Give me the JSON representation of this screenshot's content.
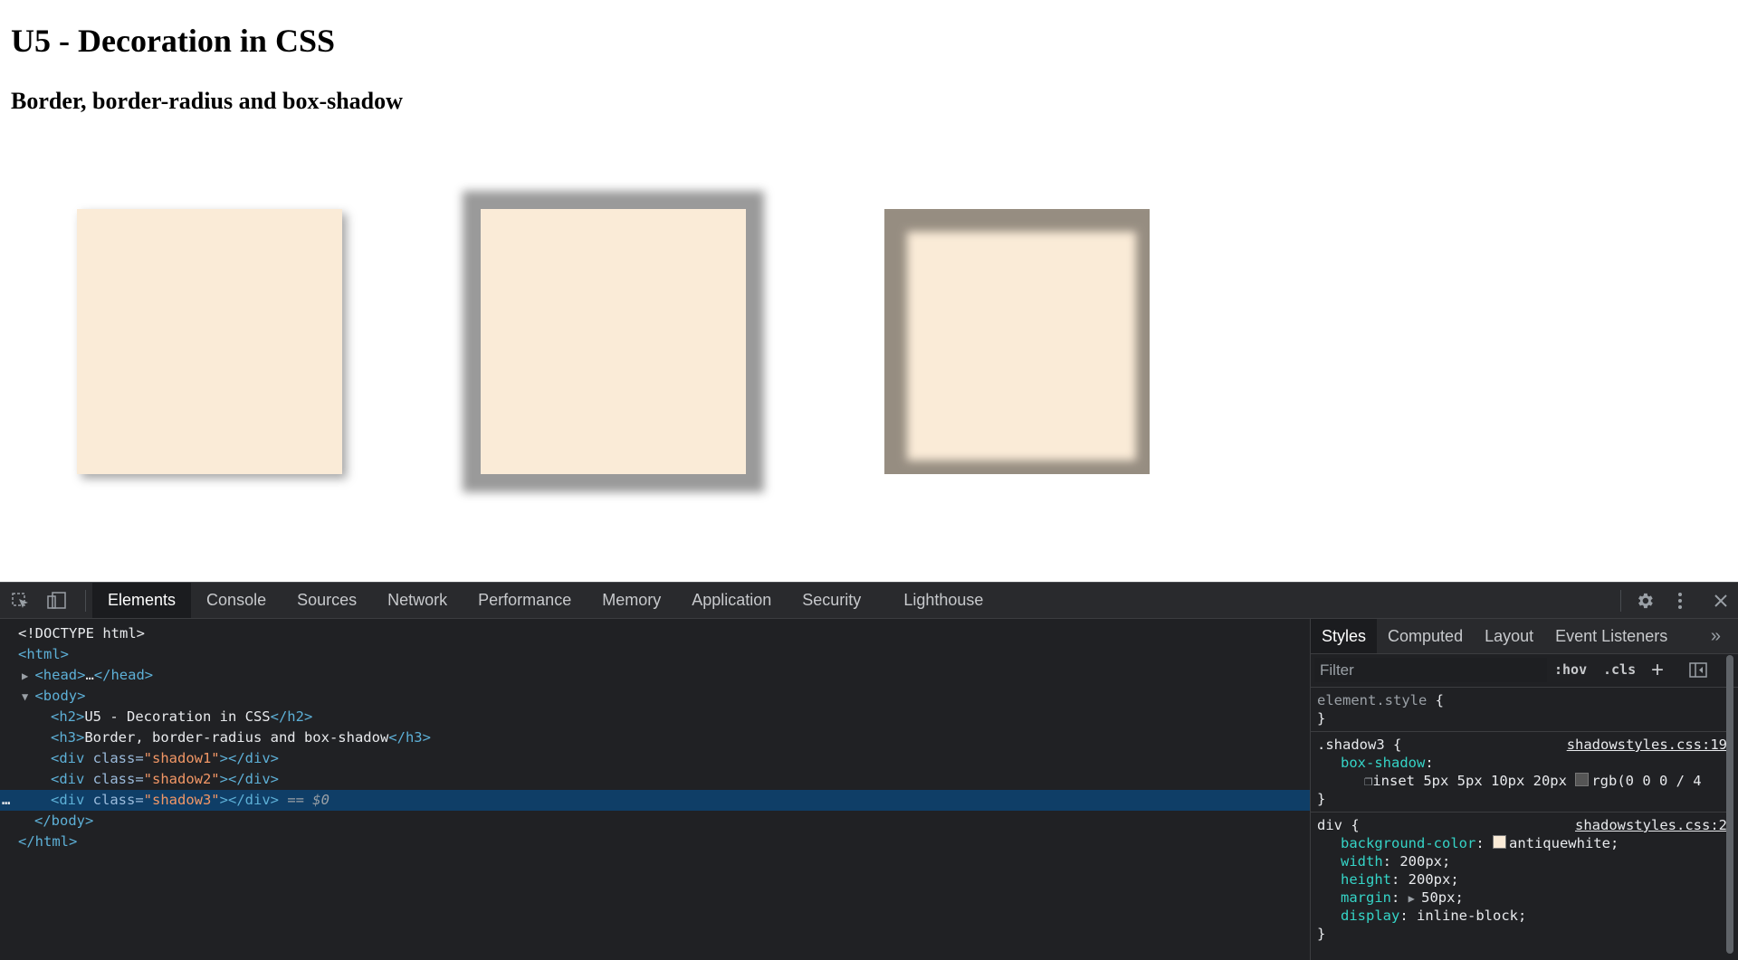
{
  "page": {
    "h2": "U5 - Decoration in CSS",
    "h3": "Border, border-radius and box-shadow",
    "background_color": "#faebd7"
  },
  "devtools": {
    "tabs": [
      "Elements",
      "Console",
      "Sources",
      "Network",
      "Performance",
      "Memory",
      "Application",
      "Security",
      "Lighthouse"
    ],
    "active_tab": "Elements",
    "toolbar_icons": [
      "inspect-element-icon",
      "device-toolbar-icon",
      "settings-gear-icon",
      "more-options-icon",
      "close-icon"
    ],
    "dom": {
      "doctype": "<!DOCTYPE html>",
      "html_open": "<html>",
      "head_open": "<head>",
      "head_ellipsis": "…",
      "head_close": "</head>",
      "body_open": "<body>",
      "h2_open": "<h2>",
      "h2_text": "U5 - Decoration in CSS",
      "h2_close": "</h2>",
      "h3_open": "<h3>",
      "h3_text": "Border, border-radius and box-shadow",
      "h3_close": "</h3>",
      "div_open": "<div",
      "class_attr": " class=",
      "div_end": "></div>",
      "shadow1": "\"shadow1\"",
      "shadow2": "\"shadow2\"",
      "shadow3": "\"shadow3\"",
      "selected_marker": " == $0",
      "row_menu": "…",
      "body_close": "</body>",
      "html_close": "</html>"
    },
    "styles_panel": {
      "tabs": [
        "Styles",
        "Computed",
        "Layout",
        "Event Listeners"
      ],
      "active_tab": "Styles",
      "more": "»",
      "filter_placeholder": "Filter",
      "hov": ":hov",
      "cls": ".cls",
      "plus": "+",
      "element_style": "element.style",
      "open_brace": " {",
      "close_brace": "}",
      "shadow3_selector": ".shadow3",
      "shadow3_source": "shadowstyles.css:19",
      "box_shadow_prop": "box-shadow",
      "box_shadow_value": "inset 5px 5px 10px 20px",
      "box_shadow_color": "rgb(0 0 0 / 4",
      "div_selector": "div",
      "div_source": "shadowstyles.css:2",
      "decls": [
        {
          "prop": "background-color",
          "value": "antiquewhite;"
        },
        {
          "prop": "width",
          "value": "200px;"
        },
        {
          "prop": "height",
          "value": "200px;"
        },
        {
          "prop": "margin",
          "value": "50px;"
        },
        {
          "prop": "display",
          "value": "inline-block;"
        }
      ]
    }
  }
}
